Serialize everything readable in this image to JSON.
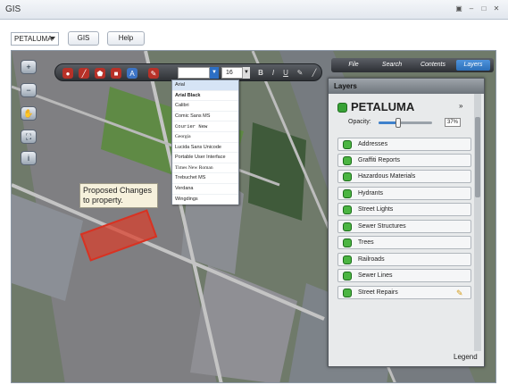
{
  "window": {
    "title": "GIS"
  },
  "controls": {
    "city_select": "PETALUMA",
    "gis_button": "GIS",
    "help_button": "Help"
  },
  "font_menu": {
    "selected": "Arial",
    "options": [
      "Arial",
      "Arial Black",
      "Calibri",
      "Comic Sans MS",
      "Courier New",
      "Georgia",
      "Lucida Sans Unicode",
      "Portable User Interface",
      "Times New Roman",
      "Trebuchet MS",
      "Verdana",
      "Wingdings"
    ]
  },
  "font_size": "16",
  "callout": {
    "text": "Proposed Changes to property."
  },
  "tabs": [
    "File",
    "Search",
    "Contents",
    "Layers"
  ],
  "layers_panel": {
    "header": "Layers",
    "group": "PETALUMA",
    "opacity_label": "Opacity:",
    "opacity_value": "37%",
    "opacity_fraction": 0.37,
    "items": [
      "Addresses",
      "Graffiti Reports",
      "Hazardous Materials",
      "Hydrants",
      "Street Lights",
      "Sewer Structures",
      "Trees",
      "Railroads",
      "Sewer Lines",
      "Street Repairs"
    ],
    "legend": "Legend"
  }
}
